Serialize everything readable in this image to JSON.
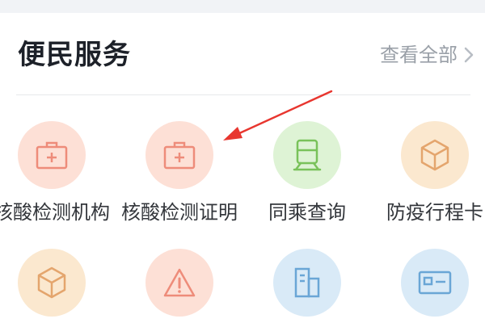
{
  "section": {
    "title": "便民服务",
    "view_all": "查看全部"
  },
  "services": [
    {
      "label": "核酸检测机构",
      "icon": "medical-kit-icon",
      "bg": "#fde0d6",
      "fg": "#ee8c7a"
    },
    {
      "label": "核酸检测证明",
      "icon": "medical-kit-icon",
      "bg": "#fde0d6",
      "fg": "#ee8c7a"
    },
    {
      "label": "同乘查询",
      "icon": "train-icon",
      "bg": "#def3d5",
      "fg": "#79c25a"
    },
    {
      "label": "防疫行程卡",
      "icon": "cube-icon",
      "bg": "#fbe8cf",
      "fg": "#e4a56d"
    },
    {
      "label": "",
      "icon": "cube-icon",
      "bg": "#fbe8cf",
      "fg": "#e4a56d"
    },
    {
      "label": "",
      "icon": "warning-icon",
      "bg": "#fde0d6",
      "fg": "#ee8c7a"
    },
    {
      "label": "",
      "icon": "building-icon",
      "bg": "#d9eaf7",
      "fg": "#6aa6d6"
    },
    {
      "label": "",
      "icon": "id-card-icon",
      "bg": "#d9eaf7",
      "fg": "#6aa6d6"
    }
  ],
  "annotation": {
    "color": "#e8362f"
  }
}
